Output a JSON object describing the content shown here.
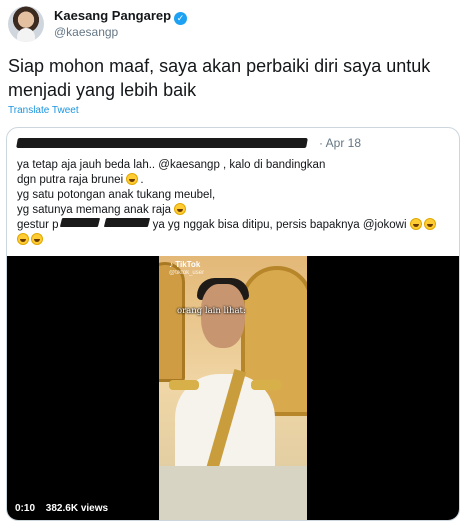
{
  "tweet": {
    "author_name": "Kaesang Pangarep",
    "handle": "@kaesangp",
    "verified_mark": "✓",
    "text": "Siap mohon maaf, saya akan perbaiki diri saya untuk menjadi yang lebih baik",
    "translate_label": "Translate Tweet"
  },
  "quoted": {
    "date": "· Apr 18",
    "lines": [
      "ya tetap aja jauh beda lah.. @kaesangp , kalo di bandingkan",
      "dgn  putra raja brunei",
      "yg satu potongan anak tukang meubel,",
      "yg satunya memang anak raja",
      "gestur p",
      "ya yg nggak bisa ditipu,  persis bapaknya @jokowi"
    ],
    "video": {
      "tiktok_label": "♪ TikTok",
      "tiktok_handle": "@tiktok_user",
      "caption": "orang lain lihat:",
      "time": "0:10",
      "views": "382.6K views"
    }
  },
  "icons": {
    "avatar": "profile-photo",
    "verified": "verified-badge-icon",
    "emoji": "grinning-face-emoji"
  },
  "colors": {
    "link": "#1b95e0",
    "verified": "#1da1f2",
    "muted": "#657786"
  }
}
